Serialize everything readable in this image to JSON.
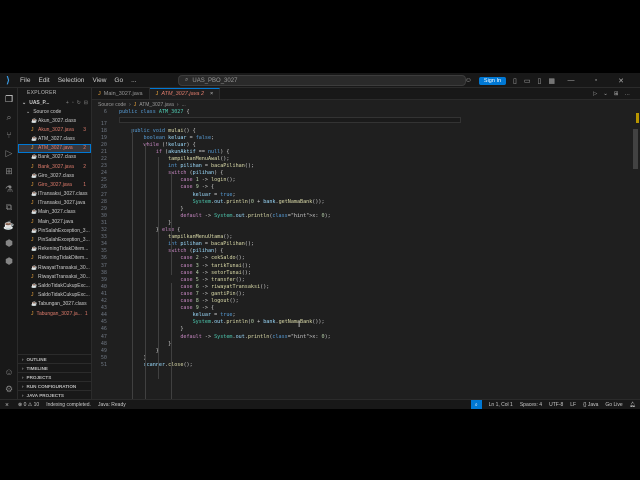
{
  "titlebar": {
    "menu": [
      "File",
      "Edit",
      "Selection",
      "View",
      "Go",
      "..."
    ],
    "search": "UAS_PBO_3027",
    "signin": "Sign In"
  },
  "sidebar": {
    "header": "EXPLORER",
    "project": "UAS_P...",
    "folder": "Source code",
    "files": [
      {
        "name": "Akun_3027.class",
        "type": "class",
        "badge": ""
      },
      {
        "name": "Akun_3027.java",
        "type": "java",
        "badge": "3"
      },
      {
        "name": "ATM_3027.class",
        "type": "class",
        "badge": ""
      },
      {
        "name": "ATM_3027.java",
        "type": "java",
        "badge": "2"
      },
      {
        "name": "Bank_3027.class",
        "type": "class",
        "badge": ""
      },
      {
        "name": "Bank_3027.java",
        "type": "java",
        "badge": "2"
      },
      {
        "name": "Giro_3027.class",
        "type": "class",
        "badge": ""
      },
      {
        "name": "Giro_3027.java",
        "type": "java",
        "badge": "1"
      },
      {
        "name": "ITransaksi_3027.class",
        "type": "class",
        "badge": ""
      },
      {
        "name": "ITransaksi_3027.java",
        "type": "java",
        "badge": ""
      },
      {
        "name": "Main_3027.class",
        "type": "class",
        "badge": ""
      },
      {
        "name": "Main_3027.java",
        "type": "java",
        "badge": ""
      },
      {
        "name": "PinSalahException_3...",
        "type": "class",
        "badge": ""
      },
      {
        "name": "PinSalahException_3...",
        "type": "java",
        "badge": ""
      },
      {
        "name": "RekeningTidakDitem...",
        "type": "class",
        "badge": ""
      },
      {
        "name": "RekeningTidakDitem...",
        "type": "java",
        "badge": ""
      },
      {
        "name": "RiwayatTransaksi_30...",
        "type": "class",
        "badge": ""
      },
      {
        "name": "RiwayatTransaksi_30...",
        "type": "java",
        "badge": ""
      },
      {
        "name": "SaldoTidakCukupExc...",
        "type": "class",
        "badge": ""
      },
      {
        "name": "SaldoTidakCukupExc...",
        "type": "java",
        "badge": ""
      },
      {
        "name": "Tabungan_3027.class",
        "type": "class",
        "badge": ""
      },
      {
        "name": "Tabungan_3027.ja...",
        "type": "java",
        "badge": "1"
      }
    ],
    "sections": [
      "OUTLINE",
      "TIMELINE",
      "PROJECTS",
      "RUN CONFIGURATION",
      "JAVA PROJECTS"
    ]
  },
  "editor": {
    "tabs": [
      {
        "label": "Main_3027.java",
        "active": false
      },
      {
        "label": "ATM_3027.java 2",
        "active": true
      }
    ],
    "breadcrumb": [
      "Source code",
      "ATM_3027.java",
      "..."
    ],
    "lines": [
      {
        "n": "6",
        "text": "public class ATM_3027 {"
      },
      {
        "n": "17",
        "text": ""
      },
      {
        "n": "18",
        "text": "    public void mulai() {"
      },
      {
        "n": "19",
        "text": "        boolean keluar = false;"
      },
      {
        "n": "20",
        "text": "        while (!keluar) {"
      },
      {
        "n": "21",
        "text": "            if (akunAktif == null) {"
      },
      {
        "n": "22",
        "text": "                tampilkanMenuAwal();"
      },
      {
        "n": "23",
        "text": "                int pilihan = bacaPilihan();"
      },
      {
        "n": "24",
        "text": "                switch (pilihan) {"
      },
      {
        "n": "25",
        "text": "                    case 1 -> login();"
      },
      {
        "n": "26",
        "text": "                    case 9 -> {"
      },
      {
        "n": "27",
        "text": "                        keluar = true;"
      },
      {
        "n": "28",
        "text": "                        System.out.println(\"Terima kasih telah menggunakan ATM Bank \" + bank.getNamaBank());"
      },
      {
        "n": "29",
        "text": "                    }"
      },
      {
        "n": "30",
        "text": "                    default -> System.out.println(x: \"Pilihan tidak valid.\\n\");"
      },
      {
        "n": "31",
        "text": "                }"
      },
      {
        "n": "32",
        "text": "            } else {"
      },
      {
        "n": "33",
        "text": "                tampilkanMenuUtama();"
      },
      {
        "n": "34",
        "text": "                int pilihan = bacaPilihan();"
      },
      {
        "n": "35",
        "text": "                switch (pilihan) {"
      },
      {
        "n": "36",
        "text": "                    case 2 -> cekSaldo();"
      },
      {
        "n": "37",
        "text": "                    case 3 -> tarikTunai();"
      },
      {
        "n": "38",
        "text": "                    case 4 -> setorTunai();"
      },
      {
        "n": "39",
        "text": "                    case 5 -> transfer();"
      },
      {
        "n": "40",
        "text": "                    case 6 -> riwayatTransaksi();"
      },
      {
        "n": "41",
        "text": "                    case 7 -> gantiPin();"
      },
      {
        "n": "42",
        "text": "                    case 8 -> logout();"
      },
      {
        "n": "43",
        "text": "                    case 9 -> {"
      },
      {
        "n": "44",
        "text": "                        keluar = true;"
      },
      {
        "n": "45",
        "text": "                        System.out.println(\"Terima kasih telah menggunakan ATM Bank \" + bank.getNamaBank());"
      },
      {
        "n": "46",
        "text": "                    }"
      },
      {
        "n": "47",
        "text": "                    default -> System.out.println(x: \"Pilihan tidak valid.\\n\");"
      },
      {
        "n": "48",
        "text": "                }"
      },
      {
        "n": "49",
        "text": "            }"
      },
      {
        "n": "50",
        "text": "        }"
      },
      {
        "n": "51",
        "text": "        scanner.close();"
      }
    ]
  },
  "status": {
    "left": [
      "⊗ 0 ⚠ 10",
      "Indexing completed.",
      "Java: Ready"
    ],
    "right": [
      "Ln 1, Col 1",
      "Spaces: 4",
      "UTF-8",
      "LF",
      "{} Java",
      "Go Live"
    ]
  }
}
